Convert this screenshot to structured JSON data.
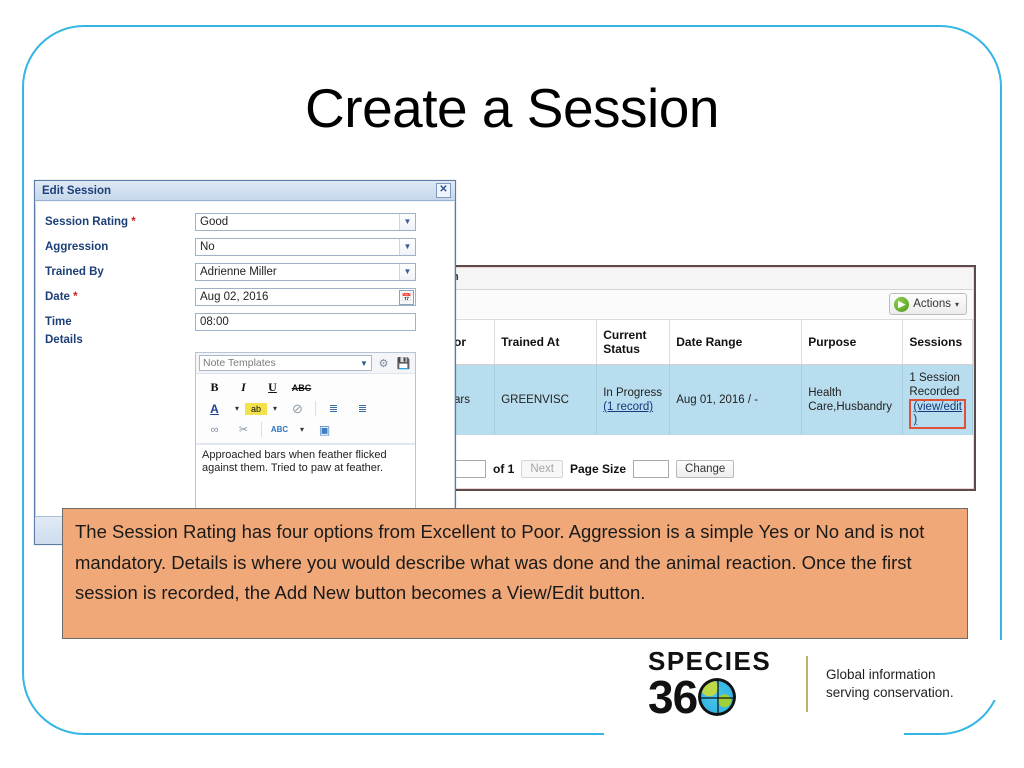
{
  "slide": {
    "title": "Create a Session",
    "frame_color": "#35b6e5"
  },
  "dialog": {
    "title": "Edit Session",
    "close_label": "✕",
    "fields": [
      {
        "label": "Session Rating ",
        "required": "*",
        "value": "Good",
        "type": "select"
      },
      {
        "label": "Aggression",
        "required": "",
        "value": "No",
        "type": "select"
      },
      {
        "label": "Trained By",
        "required": "",
        "value": "Adrienne Miller",
        "type": "select"
      },
      {
        "label": "Date ",
        "required": "*",
        "value": "Aug 02, 2016",
        "type": "date"
      },
      {
        "label": "Time",
        "required": "",
        "value": "08:00",
        "type": "text"
      },
      {
        "label": "Details",
        "required": "",
        "value": "",
        "type": "editor"
      }
    ],
    "editor": {
      "note_templates_placeholder": "Note Templates",
      "settings_icon": "gear-icon",
      "save_icon": "save-icon",
      "toolbar_row1": [
        "B",
        "I",
        "U",
        "ABC"
      ],
      "toolbar_row2": [
        "A",
        "▾",
        "ab",
        "▾",
        "⊘",
        "≣",
        "≣"
      ],
      "toolbar_row3": [
        "∞",
        "✂",
        "ABC",
        "▾",
        "▣"
      ],
      "body_text": "Approached bars when feather flicked against them. Tried to paw at feather."
    }
  },
  "background_page": {
    "tab_label": "n",
    "actions_button": "Actions",
    "actions_caret": "▾",
    "table": {
      "headers": [
        "or",
        "Trained At",
        "Current Status",
        "Date Range",
        "Purpose",
        "Sessions"
      ],
      "rows": [
        {
          "trainer": "ars",
          "trained_at": "GREENVISC",
          "current_status": "In Progress",
          "current_status_link": "(1 record)",
          "date_range": "Aug 01, 2016 / -",
          "purpose": "Health Care,Husbandry",
          "sessions": "1 Session Recorded",
          "sessions_link": "(view/edit )"
        }
      ]
    },
    "pager": {
      "page_value": "",
      "of_label": "of 1",
      "next_label": "Next",
      "page_size_label": "Page Size",
      "page_size_value": "",
      "change_label": "Change"
    }
  },
  "caption": {
    "text": "The Session Rating has four options from Excellent to Poor. Aggression is a simple Yes or No and is not mandatory. Details is where you would describe what was done and the animal reaction. Once the first session  is recorded, the Add New button becomes a View/Edit button."
  },
  "logo": {
    "species": "SPECIES",
    "number": "36",
    "tagline_line1": "Global information",
    "tagline_line2": "serving conservation."
  }
}
